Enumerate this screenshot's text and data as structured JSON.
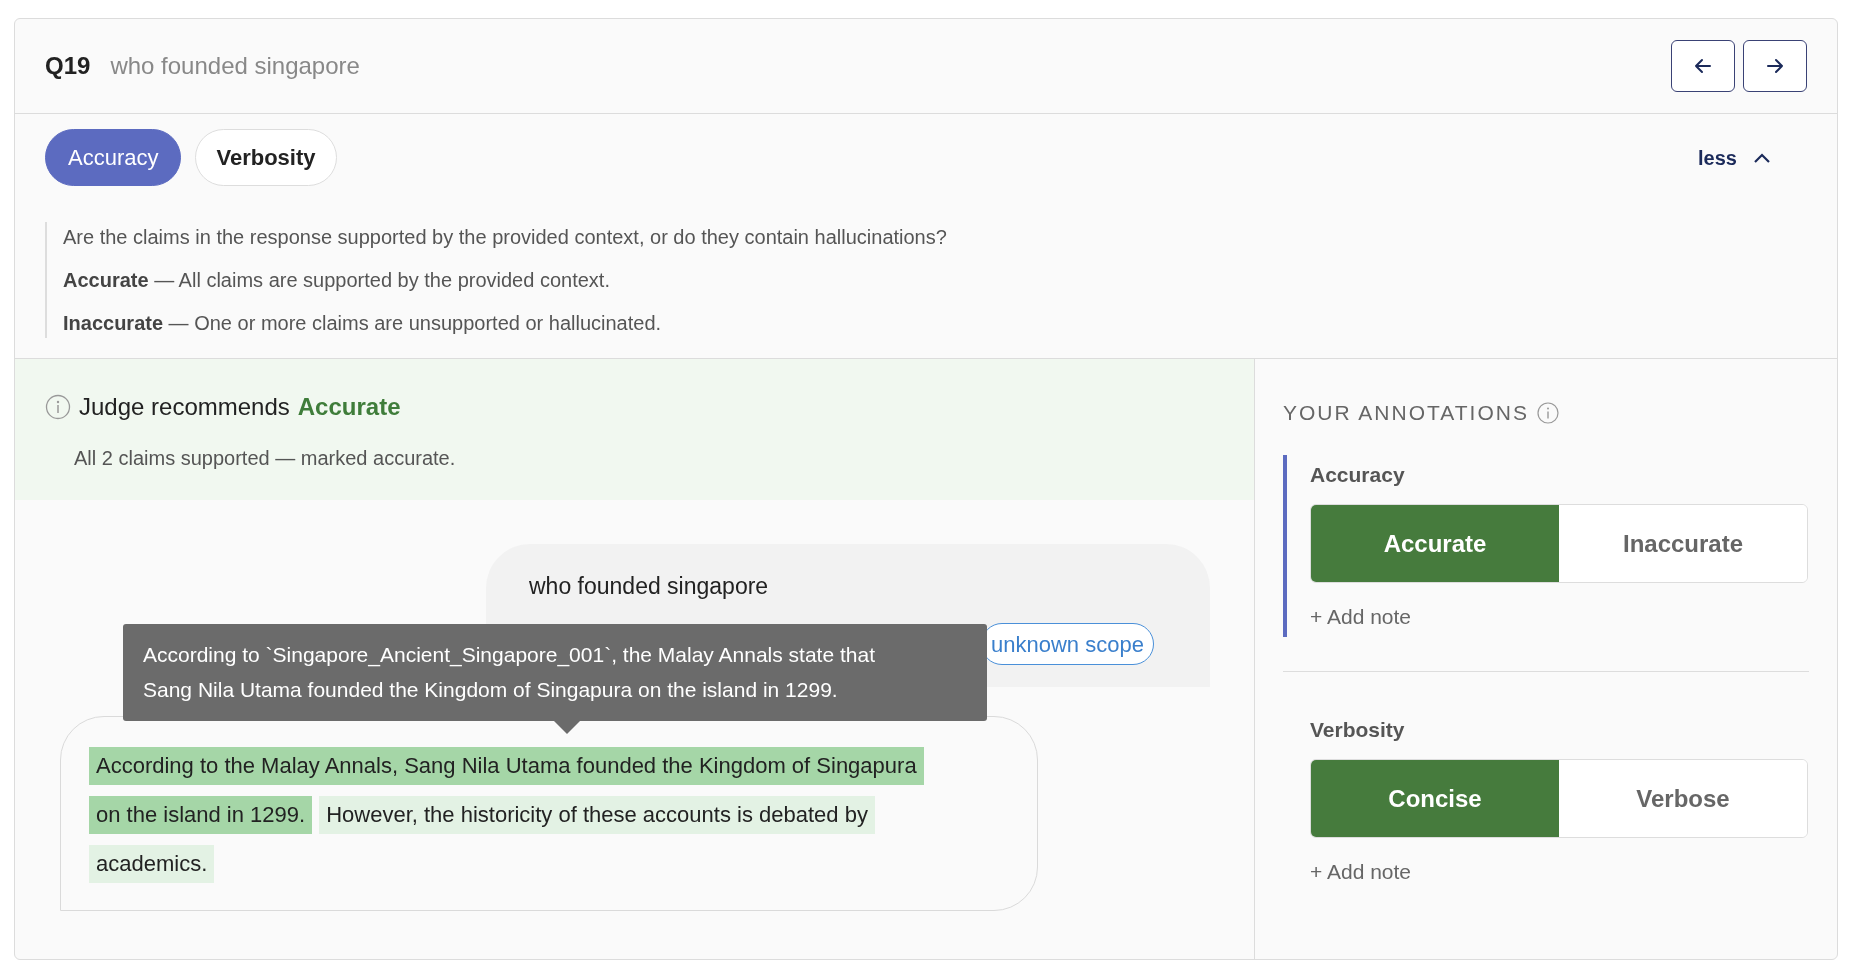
{
  "question": {
    "number": "Q19",
    "text": "who founded singapore"
  },
  "nav_buttons": [
    {
      "kind": "prev"
    },
    {
      "kind": "next"
    }
  ],
  "criteria_tabs": [
    {
      "label": "Accuracy",
      "selected": true
    },
    {
      "label": "Verbosity",
      "selected": false
    }
  ],
  "toggle": {
    "label": "less",
    "expanded": true
  },
  "description": {
    "question": "Are the claims in the response supported by the provided context, or do they contain hallucinations?",
    "definitions": [
      "**Accurate** — All claims are supported by the provided context.",
      "**Inaccurate** — One or more claims are unsupported or hallucinated."
    ]
  },
  "judge": {
    "label": "Judge recommends",
    "verdict": "Accurate",
    "summary": "All 2 claims supported — marked accurate."
  },
  "chat": {
    "user_message": "who founded singapore",
    "tags": [
      "unknown scope"
    ],
    "tooltip": "According to `Singapore_Ancient_Singapore_001`, the Malay Annals state that Sang Nila Utama founded the Kingdom of Singapura on the island in 1299.",
    "response_segments": [
      {
        "lines": [
          "According to the Malay Annals, Sang Nila Utama founded the Kingdom of Singapura",
          "on the island in 1299."
        ],
        "kind": "strong"
      },
      {
        "lines": [
          "However, the historicity of these accounts is debated by",
          "academics."
        ],
        "kind": "light"
      }
    ]
  },
  "annotations": {
    "title": "YOUR ANNOTATIONS",
    "criteria": [
      {
        "name": "Accuracy",
        "active": true,
        "options": [
          {
            "label": "Accurate",
            "selected": true
          },
          {
            "label": "Inaccurate",
            "selected": false
          }
        ],
        "add_note": "+ Add note"
      },
      {
        "name": "Verbosity",
        "active": false,
        "options": [
          {
            "label": "Concise",
            "selected": true
          },
          {
            "label": "Verbose",
            "selected": false
          }
        ],
        "add_note": "+ Add note"
      }
    ]
  }
}
